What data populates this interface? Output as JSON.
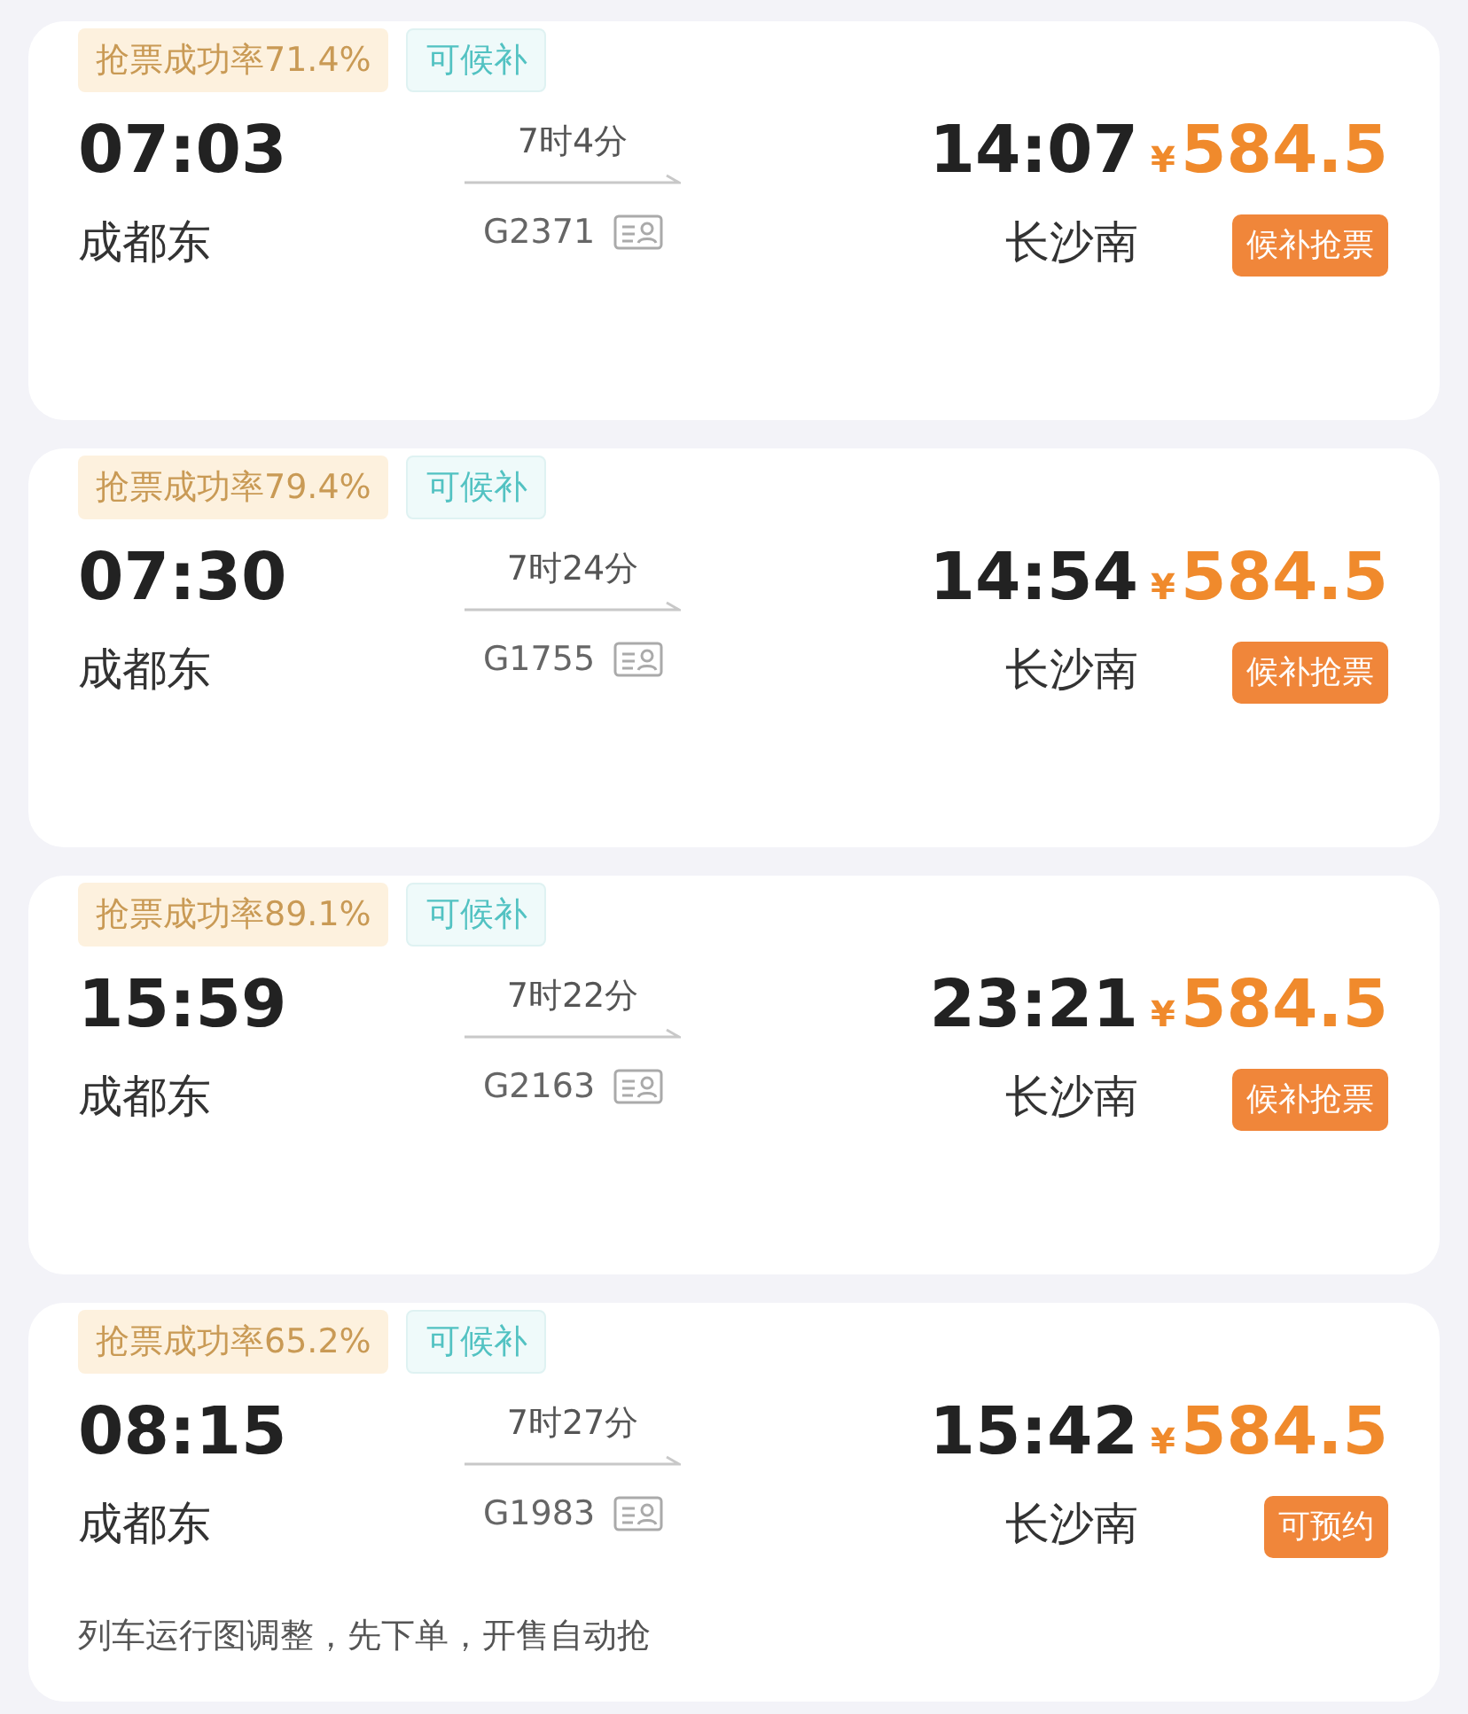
{
  "trains": [
    {
      "success_rate": "抢票成功率71.4%",
      "waitlist_tag": "可候补",
      "depart_time": "07:03",
      "depart_station": "成都东",
      "duration": "7时4分",
      "train_no": "G2371",
      "arrive_time": "14:07",
      "arrive_station": "长沙南",
      "currency": "¥",
      "price": "584.5",
      "action": "候补抢票"
    },
    {
      "success_rate": "抢票成功率79.4%",
      "waitlist_tag": "可候补",
      "depart_time": "07:30",
      "depart_station": "成都东",
      "duration": "7时24分",
      "train_no": "G1755",
      "arrive_time": "14:54",
      "arrive_station": "长沙南",
      "currency": "¥",
      "price": "584.5",
      "action": "候补抢票"
    },
    {
      "success_rate": "抢票成功率89.1%",
      "waitlist_tag": "可候补",
      "depart_time": "15:59",
      "depart_station": "成都东",
      "duration": "7时22分",
      "train_no": "G2163",
      "arrive_time": "23:21",
      "arrive_station": "长沙南",
      "currency": "¥",
      "price": "584.5",
      "action": "候补抢票"
    },
    {
      "success_rate": "抢票成功率65.2%",
      "waitlist_tag": "可候补",
      "depart_time": "08:15",
      "depart_station": "成都东",
      "duration": "7时27分",
      "train_no": "G1983",
      "arrive_time": "15:42",
      "arrive_station": "长沙南",
      "currency": "¥",
      "price": "584.5",
      "action": "可预约",
      "note": "列车运行图调整，先下单，开售自动抢"
    }
  ]
}
